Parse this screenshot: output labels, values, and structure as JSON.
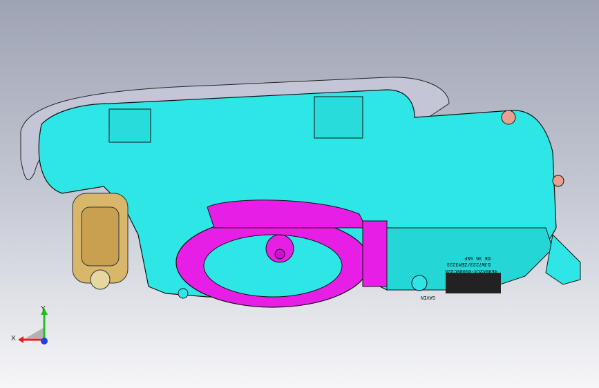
{
  "viewport": {
    "background_top": "#9ea3b4",
    "background_bottom": "#f6f6f8"
  },
  "model": {
    "housing_color": "#2ee6e6",
    "ring_color": "#e61ee6",
    "gasket_color": "#bcbcd0",
    "connector_color": "#d8b66a",
    "label_text_line1": "DJW7223/ZEM3223",
    "label_text_line2": "4E9B42C4-0S000C32A",
    "label_text_line3": "DE 36 SSF",
    "label_brand": "SAVIN"
  },
  "triad": {
    "x_label": "X",
    "y_label": "Y",
    "x_color": "#e02020",
    "y_color": "#20c020",
    "z_color": "#2040e0"
  }
}
